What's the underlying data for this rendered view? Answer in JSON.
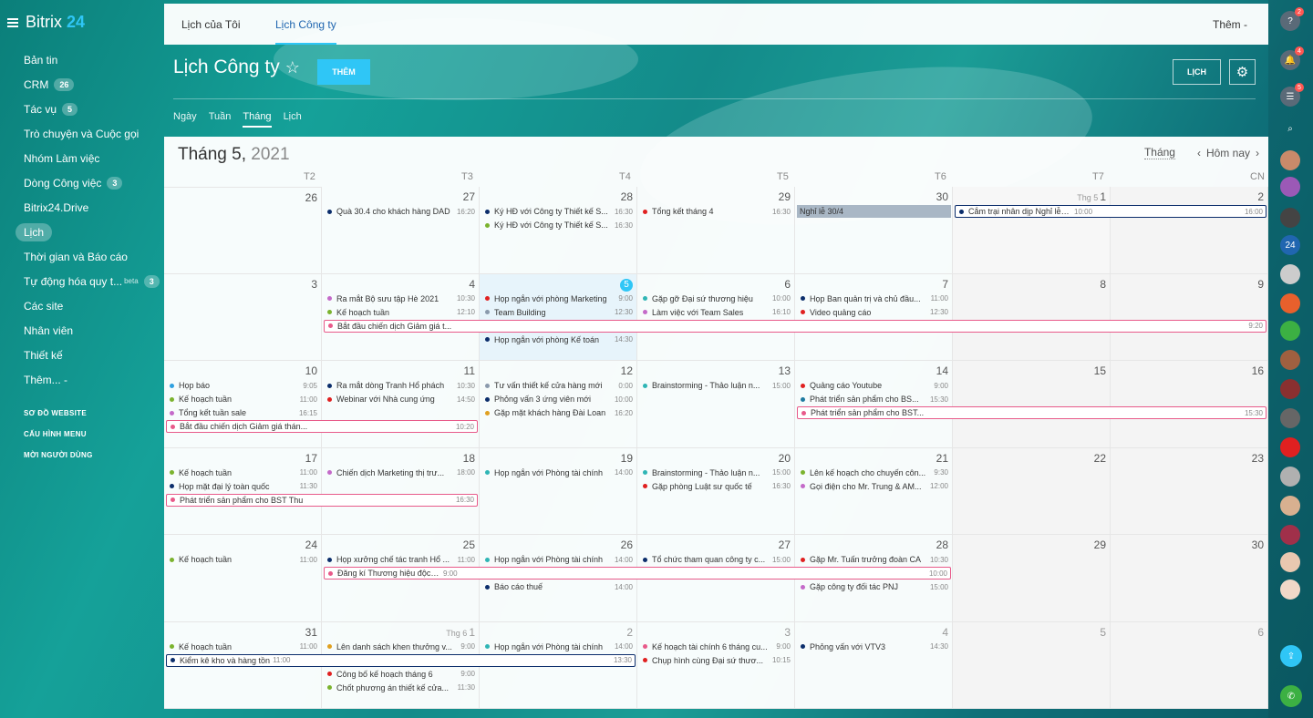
{
  "app": {
    "logo_text": "Bitrix",
    "logo_num": "24"
  },
  "sidebar": {
    "items": [
      {
        "label": "Bản tin"
      },
      {
        "label": "CRM",
        "count": "26"
      },
      {
        "label": "Tác vụ",
        "count": "5"
      },
      {
        "label": "Trò chuyện và Cuộc gọi"
      },
      {
        "label": "Nhóm Làm việc"
      },
      {
        "label": "Dòng Công việc",
        "count": "3"
      },
      {
        "label": "Bitrix24.Drive"
      },
      {
        "label": "Lịch",
        "active": true
      },
      {
        "label": "Thời gian và Báo cáo"
      },
      {
        "label": "Tự động hóa quy t...",
        "sup": "beta",
        "count": "3"
      },
      {
        "label": "Các site"
      },
      {
        "label": "Nhân viên"
      },
      {
        "label": "Thiết kế"
      },
      {
        "label": "Thêm... -"
      }
    ],
    "sub": [
      "Sơ đồ website",
      "Cấu hình menu",
      "Mời người dùng"
    ]
  },
  "topbar": {
    "tabs": [
      "Lịch của Tôi",
      "Lịch Công ty"
    ],
    "more": "Thêm -"
  },
  "header": {
    "title": "Lịch Công ty",
    "star": "☆",
    "add": "THÊM",
    "calendar_btn": "LỊCH",
    "gear": "⚙"
  },
  "views": [
    "Ngày",
    "Tuần",
    "Tháng",
    "Lịch"
  ],
  "calendar": {
    "month": "Tháng 5,",
    "year": "2021",
    "mode": "Tháng",
    "today": "Hôm nay",
    "weekdays": [
      "T2",
      "T3",
      "T4",
      "T5",
      "T6",
      "T7",
      "CN"
    ],
    "weeks": [
      {
        "days": [
          {
            "n": "26"
          },
          {
            "n": "27"
          },
          {
            "n": "28"
          },
          {
            "n": "29"
          },
          {
            "n": "30"
          },
          {
            "n": "1",
            "mon": "Thg 5"
          },
          {
            "n": "2"
          }
        ],
        "events": [
          {
            "col": 1,
            "row": 0,
            "t": "Quà 30.4 cho khách hàng DAD",
            "tm": "16:20",
            "c": "#0b2d6b"
          },
          {
            "col": 2,
            "row": 0,
            "t": "Ký HĐ với Công ty Thiết kế S...",
            "tm": "16:30",
            "c": "#0b2d6b"
          },
          {
            "col": 2,
            "row": 1,
            "t": "Ký HĐ với Công ty Thiết kế S...",
            "tm": "16:30",
            "c": "#7bb32e"
          },
          {
            "col": 3,
            "row": 0,
            "t": "Tổng kết tháng 4",
            "tm": "16:30",
            "c": "#e02020"
          },
          {
            "col": 4,
            "row": 0,
            "t": "Nghỉ lễ 30/4",
            "tm": "",
            "c": "#a9b7c5",
            "fill": true
          },
          {
            "col": 5,
            "row": 0,
            "span": 2,
            "t": "Cắm trại nhân dịp Nghỉ lễ Qu...",
            "tm": "10:00",
            "tm2": "16:00",
            "c": "#0b2d6b",
            "bar": true
          }
        ]
      },
      {
        "days": [
          {
            "n": "3"
          },
          {
            "n": "4"
          },
          {
            "n": "5",
            "today": true
          },
          {
            "n": "6"
          },
          {
            "n": "7"
          },
          {
            "n": "8"
          },
          {
            "n": "9"
          }
        ],
        "events": [
          {
            "col": 1,
            "row": 0,
            "t": "Ra mắt Bộ sưu tập Hè 2021",
            "tm": "10:30",
            "c": "#c46ac9"
          },
          {
            "col": 1,
            "row": 1,
            "t": "Kế hoạch tuần",
            "tm": "12:10",
            "c": "#7bb32e"
          },
          {
            "col": 1,
            "row": 2,
            "span": 6,
            "t": "Bắt đầu chiến dịch Giảm giá t...",
            "tm": "9:20",
            "c": "#e85a8a",
            "bar": true
          },
          {
            "col": 2,
            "row": 0,
            "t": "Họp ngắn với phòng Marketing",
            "tm": "9:00",
            "c": "#e02020"
          },
          {
            "col": 2,
            "row": 1,
            "t": "Team Building",
            "tm": "12:30",
            "c": "#8a9aac"
          },
          {
            "col": 2,
            "row": 3,
            "t": "Họp ngắn với phòng Kế toán",
            "tm": "14:30",
            "c": "#0b2d6b"
          },
          {
            "col": 3,
            "row": 0,
            "t": "Gặp gỡ Đại sứ thương hiệu",
            "tm": "10:00",
            "c": "#2fb5b5"
          },
          {
            "col": 3,
            "row": 1,
            "t": "Làm việc với Team Sales",
            "tm": "16:10",
            "c": "#c46ac9"
          },
          {
            "col": 4,
            "row": 0,
            "t": "Họp Ban quản trị và chủ đầu...",
            "tm": "11:00",
            "c": "#0b2d6b"
          },
          {
            "col": 4,
            "row": 1,
            "t": "Video quảng cáo",
            "tm": "12:30",
            "c": "#e02020"
          }
        ]
      },
      {
        "days": [
          {
            "n": "10"
          },
          {
            "n": "11"
          },
          {
            "n": "12"
          },
          {
            "n": "13"
          },
          {
            "n": "14"
          },
          {
            "n": "15"
          },
          {
            "n": "16"
          }
        ],
        "events": [
          {
            "col": 0,
            "row": 0,
            "t": "Họp báo",
            "tm": "9:05",
            "c": "#2fa0e0"
          },
          {
            "col": 0,
            "row": 1,
            "t": "Kế hoạch tuần",
            "tm": "11:00",
            "c": "#7bb32e"
          },
          {
            "col": 0,
            "row": 2,
            "t": "Tổng kết tuần sale",
            "tm": "16:15",
            "c": "#c46ac9"
          },
          {
            "col": 0,
            "row": 3,
            "span": 2,
            "t": "Bắt đầu chiến dịch Giảm giá thán...",
            "tm": "10:20",
            "c": "#e85a8a",
            "bar": true
          },
          {
            "col": 1,
            "row": 0,
            "t": "Ra mắt dòng Tranh Hổ phách",
            "tm": "10:30",
            "c": "#0b2d6b"
          },
          {
            "col": 1,
            "row": 1,
            "t": "Webinar với Nhà cung ứng",
            "tm": "14:50",
            "c": "#e02020"
          },
          {
            "col": 2,
            "row": 0,
            "t": "Tư vấn thiết kế cửa hàng mới",
            "tm": "0:00",
            "c": "#8a9aac"
          },
          {
            "col": 2,
            "row": 1,
            "t": "Phỏng vấn 3 ứng viên mới",
            "tm": "10:00",
            "c": "#0b2d6b"
          },
          {
            "col": 2,
            "row": 2,
            "t": "Gặp mặt khách hàng Đài Loan",
            "tm": "16:20",
            "c": "#e0a020"
          },
          {
            "col": 3,
            "row": 0,
            "t": "Brainstorming - Thảo luận n...",
            "tm": "15:00",
            "c": "#2fb5b5"
          },
          {
            "col": 4,
            "row": 0,
            "t": "Quảng cáo Youtube",
            "tm": "9:00",
            "c": "#e02020"
          },
          {
            "col": 4,
            "row": 1,
            "t": "Phát triển sản phẩm cho BS...",
            "tm": "15:30",
            "c": "#1e7aa0"
          },
          {
            "col": 4,
            "row": 2,
            "span": 3,
            "t": "Phát triển sản phẩm cho BST...",
            "tm": "15:30",
            "c": "#e85a8a",
            "bar": true
          }
        ]
      },
      {
        "days": [
          {
            "n": "17"
          },
          {
            "n": "18"
          },
          {
            "n": "19"
          },
          {
            "n": "20"
          },
          {
            "n": "21"
          },
          {
            "n": "22"
          },
          {
            "n": "23"
          }
        ],
        "events": [
          {
            "col": 0,
            "row": 0,
            "t": "Kế hoạch tuần",
            "tm": "11:00",
            "c": "#7bb32e"
          },
          {
            "col": 0,
            "row": 1,
            "t": "Họp mặt đại lý toàn quốc",
            "tm": "11:30",
            "c": "#0b2d6b"
          },
          {
            "col": 0,
            "row": 2,
            "span": 2,
            "t": "Phát triển sản phẩm cho BST Thu",
            "tm": "16:30",
            "c": "#e85a8a",
            "bar": true
          },
          {
            "col": 1,
            "row": 0,
            "t": "Chiến dịch Marketing thị trư...",
            "tm": "18:00",
            "c": "#c46ac9"
          },
          {
            "col": 2,
            "row": 0,
            "t": "Họp ngắn với Phòng tài chính",
            "tm": "14:00",
            "c": "#2fb5b5"
          },
          {
            "col": 3,
            "row": 0,
            "t": "Brainstorming - Thảo luận n...",
            "tm": "15:00",
            "c": "#2fb5b5"
          },
          {
            "col": 3,
            "row": 1,
            "t": "Gặp phòng Luật sư quốc tế",
            "tm": "16:30",
            "c": "#e02020"
          },
          {
            "col": 4,
            "row": 0,
            "t": "Lên kế hoạch cho chuyến côn...",
            "tm": "9:30",
            "c": "#7bb32e"
          },
          {
            "col": 4,
            "row": 1,
            "t": "Gọi điện cho Mr. Trung & AM...",
            "tm": "12:00",
            "c": "#c46ac9"
          }
        ]
      },
      {
        "days": [
          {
            "n": "24"
          },
          {
            "n": "25"
          },
          {
            "n": "26"
          },
          {
            "n": "27"
          },
          {
            "n": "28"
          },
          {
            "n": "29"
          },
          {
            "n": "30"
          }
        ],
        "events": [
          {
            "col": 0,
            "row": 0,
            "t": "Kế hoạch tuần",
            "tm": "11:00",
            "c": "#7bb32e"
          },
          {
            "col": 1,
            "row": 0,
            "t": "Họp xưởng chế tác tranh Hổ ...",
            "tm": "11:00",
            "c": "#0b2d6b"
          },
          {
            "col": 1,
            "row": 1,
            "span": 4,
            "t": "Đăng kí Thương hiệu độc quyền",
            "tm": "9:00",
            "tm2": "10:00",
            "c": "#e85a8a",
            "bar": true
          },
          {
            "col": 2,
            "row": 0,
            "t": "Họp ngắn với Phòng tài chính",
            "tm": "14:00",
            "c": "#2fb5b5"
          },
          {
            "col": 2,
            "row": 2,
            "t": "Báo cáo thuế",
            "tm": "14:00",
            "c": "#0b2d6b"
          },
          {
            "col": 3,
            "row": 0,
            "t": "Tổ chức tham quan công ty c...",
            "tm": "15:00",
            "c": "#0b2d6b"
          },
          {
            "col": 4,
            "row": 0,
            "t": "Gặp Mr. Tuấn trưởng đoàn CA",
            "tm": "10:30",
            "c": "#e02020"
          },
          {
            "col": 4,
            "row": 2,
            "t": "Gặp công ty đối tác PNJ",
            "tm": "15:00",
            "c": "#c46ac9"
          }
        ]
      },
      {
        "days": [
          {
            "n": "31"
          },
          {
            "n": "1",
            "mon": "Thg 6",
            "gray": true
          },
          {
            "n": "2",
            "gray": true
          },
          {
            "n": "3",
            "gray": true
          },
          {
            "n": "4",
            "gray": true
          },
          {
            "n": "5",
            "gray": true
          },
          {
            "n": "6",
            "gray": true
          }
        ],
        "events": [
          {
            "col": 0,
            "row": 0,
            "t": "Kế hoạch tuần",
            "tm": "11:00",
            "c": "#7bb32e"
          },
          {
            "col": 0,
            "row": 1,
            "span": 3,
            "t": "Kiểm kê kho và hàng tồn",
            "tm": "11:00",
            "tm2": "13:30",
            "c": "#0b2d6b",
            "bar": true
          },
          {
            "col": 1,
            "row": 0,
            "t": "Lên danh sách khen thưởng v...",
            "tm": "9:00",
            "c": "#e0a020"
          },
          {
            "col": 1,
            "row": 2,
            "t": "Công bố kế hoạch tháng 6",
            "tm": "9:00",
            "c": "#e02020"
          },
          {
            "col": 1,
            "row": 3,
            "t": "Chốt phương án thiết kế cửa...",
            "tm": "11:30",
            "c": "#7bb32e"
          },
          {
            "col": 2,
            "row": 0,
            "t": "Họp ngắn với Phòng tài chính",
            "tm": "14:00",
            "c": "#2fb5b5"
          },
          {
            "col": 3,
            "row": 0,
            "t": "Kế hoạch tài chính 6 tháng cu...",
            "tm": "9:00",
            "c": "#e85a8a"
          },
          {
            "col": 3,
            "row": 1,
            "t": "Chụp hình cùng Đại sứ thươ...",
            "tm": "10:15",
            "c": "#e02020"
          },
          {
            "col": 4,
            "row": 0,
            "t": "Phỏng vấn với VTV3",
            "tm": "14:30",
            "c": "#0b2d6b"
          }
        ]
      }
    ]
  },
  "rightbar": [
    {
      "icon": "?",
      "badge": "2",
      "color": "#5a6a78"
    },
    {
      "icon": "🔔",
      "badge": "4",
      "color": "#5a6a78"
    },
    {
      "icon": "☰",
      "badge": "5",
      "color": "#5a6a78"
    },
    {
      "icon": "⌕",
      "color": "transparent"
    },
    {
      "icon": "",
      "color": "#c98a6a"
    },
    {
      "icon": "",
      "color": "#9b59b6"
    },
    {
      "icon": "",
      "color": "#444"
    },
    {
      "icon": "24",
      "color": "#2066b0"
    },
    {
      "icon": "",
      "color": "#ccc"
    },
    {
      "icon": "",
      "color": "#e8602c"
    },
    {
      "icon": "",
      "color": "#3cb043"
    },
    {
      "icon": "",
      "color": "#a06040"
    },
    {
      "icon": "",
      "color": "#8a3030"
    },
    {
      "icon": "",
      "color": "#666"
    },
    {
      "icon": "",
      "color": "#e02020"
    },
    {
      "icon": "",
      "color": "#b0b0b0"
    },
    {
      "icon": "",
      "color": "#d8b090"
    },
    {
      "icon": "",
      "color": "#a0304a"
    },
    {
      "icon": "",
      "color": "#e9c8b0"
    },
    {
      "icon": "",
      "color": "#f0d8c8"
    }
  ]
}
